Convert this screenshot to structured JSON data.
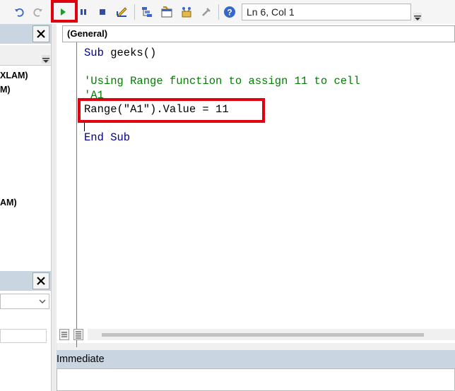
{
  "toolbar": {
    "status": "Ln 6, Col 1",
    "icons": [
      "undo-icon",
      "redo-icon",
      "run-icon",
      "break-icon",
      "reset-icon",
      "design-mode-icon",
      "project-explorer-icon",
      "properties-icon",
      "object-browser-icon",
      "toolbox-icon",
      "help-icon"
    ]
  },
  "project_panel": {
    "items": [
      "XLAM)",
      "M)",
      "AM)"
    ]
  },
  "code": {
    "object_dropdown": "(General)",
    "lines": {
      "l1_kw": "Sub",
      "l1_rest": " geeks()",
      "l2": "'Using Range function to assign 11 to cell",
      "l3": "'A1",
      "l4": "Range(\"A1\").Value = 11",
      "l5": "End Sub"
    }
  },
  "immediate": {
    "title": "Immediate"
  },
  "colors": {
    "highlight": "#e0000e",
    "comment": "#007f00",
    "keyword": "#00008b",
    "panel_header": "#c9d6e2"
  }
}
